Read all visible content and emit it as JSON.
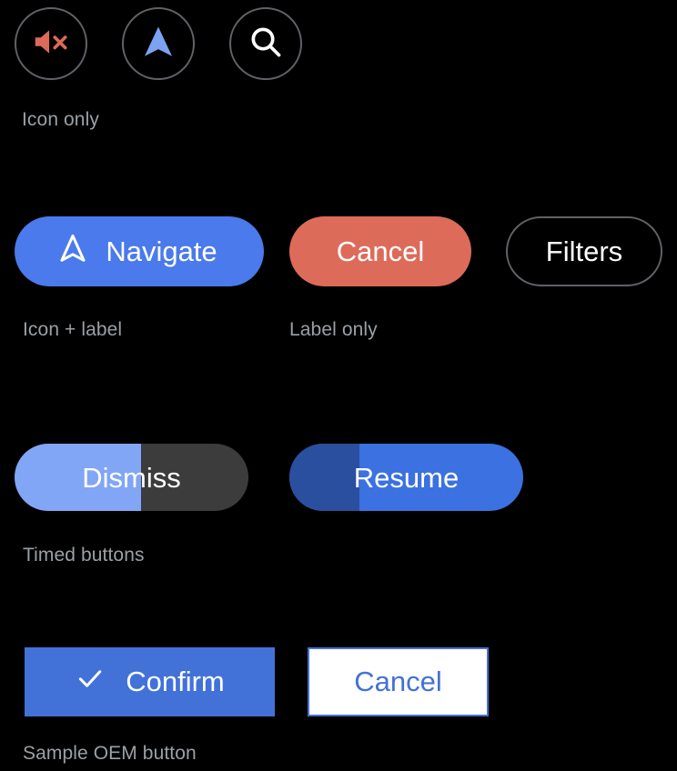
{
  "background_color": "#000000",
  "icon_row": {
    "buttons": [
      {
        "name": "mute-button",
        "icon": "volume-off-icon",
        "icon_color": "#dd6b5a",
        "border_color": "#5f6368"
      },
      {
        "name": "navigate-button",
        "icon": "navigation-icon",
        "icon_color": "#7ba3f2",
        "border_color": "#5f6368"
      },
      {
        "name": "search-button",
        "icon": "search-icon",
        "icon_color": "#ffffff",
        "border_color": "#5f6368"
      }
    ],
    "caption": "Icon only"
  },
  "pill_row": {
    "navigate": {
      "label": "Navigate",
      "icon": "navigation-outline-icon",
      "background": "#4a7aeb",
      "text_color": "#ffffff"
    },
    "cancel": {
      "label": "Cancel",
      "background": "#dd6b5a",
      "text_color": "#ffffff"
    },
    "filters": {
      "label": "Filters",
      "background": "transparent",
      "border_color": "#5f6368",
      "text_color": "#ffffff"
    },
    "caption_icon_label": "Icon + label",
    "caption_label_only": "Label only"
  },
  "timed_row": {
    "dismiss": {
      "label": "Dismiss",
      "progress_percent": 54,
      "fill_color": "#81a6f5",
      "track_color": "#3c3c3c",
      "text_color": "#ffffff"
    },
    "resume": {
      "label": "Resume",
      "progress_percent": 30,
      "fill_color": "#2a4f9e",
      "track_color": "#3b71e0",
      "text_color": "#ffffff"
    },
    "caption": "Timed buttons"
  },
  "oem_row": {
    "confirm": {
      "label": "Confirm",
      "icon": "check-icon",
      "background": "#4272d8",
      "text_color": "#ffffff"
    },
    "cancel": {
      "label": "Cancel",
      "background": "#ffffff",
      "border_color": "#4272d8",
      "text_color": "#4272d8"
    },
    "caption": "Sample OEM button"
  }
}
